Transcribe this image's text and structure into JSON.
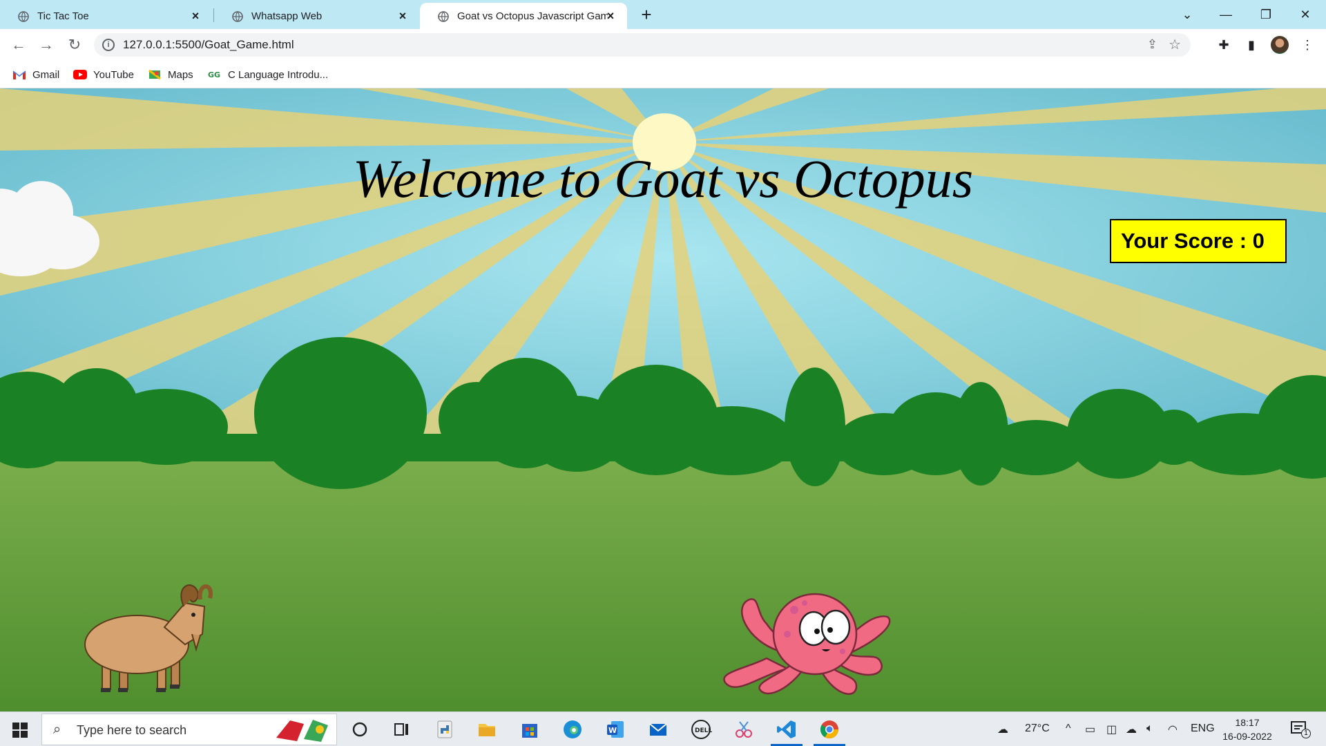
{
  "browser": {
    "tabs": [
      {
        "label": "Tic Tac Toe",
        "active": false
      },
      {
        "label": "Whatsapp Web",
        "active": false
      },
      {
        "label": "Goat vs Octopus Javascript Game",
        "active": true
      }
    ],
    "new_tab_label": "+",
    "window_controls": {
      "minimize": "—",
      "maximize": "❐",
      "close": "✕",
      "tab_search": "⌄"
    },
    "url": "127.0.0.1:5500/Goat_Game.html",
    "bookmarks": [
      "Gmail",
      "YouTube",
      "Maps",
      "C Language Introdu..."
    ]
  },
  "game": {
    "title": "Welcome to Goat vs Octopus",
    "score_label": "Your Score : 0",
    "colors": {
      "sky": "#7cc8da",
      "sun": "#fdf6c0",
      "rays": "#e8d66e",
      "trees": "#1a8224",
      "grass": "#6fa845",
      "score_bg": "#ffff00"
    }
  },
  "taskbar": {
    "search_placeholder": "Type here to search",
    "weather": "27°C",
    "language": "ENG",
    "time": "18:17",
    "date": "16-09-2022",
    "notifications": "1"
  }
}
